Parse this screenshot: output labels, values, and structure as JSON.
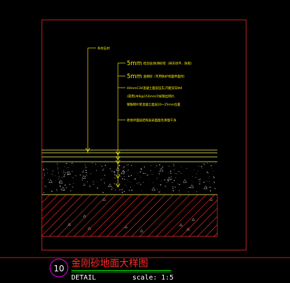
{
  "annotations": {
    "a1": "条纹石材",
    "a2_size": "5mm",
    "a2_text": "结合层/防滑砂浆（抹灰找平、防裂）",
    "a3_size": "5mm",
    "a3_text": "金刚砂（专用防护地面界面剂）",
    "a4_line1": "40mmC30混凝土面层压实,内配双向Φ4",
    "a4_line2": "(或用)/Φ6@150mm冷拔钢丝网片,",
    "a4_line3": "钢筋网片距混凝土面层20~25mm位置",
    "a5": "原地坪面层结构层表面凿毛清理干净"
  },
  "title_block": {
    "number": "10",
    "title": "金刚砂地面大样图",
    "subtitle": "DETAIL",
    "scale": "scale: 1:5"
  },
  "colors": {
    "frame": "#ff2a2a",
    "leader": "#fff200",
    "layer_line": "#ffff66",
    "concrete_dots": "#c0c0c0",
    "hatch": "#ff2a2a",
    "title_underline": "#00d000"
  }
}
